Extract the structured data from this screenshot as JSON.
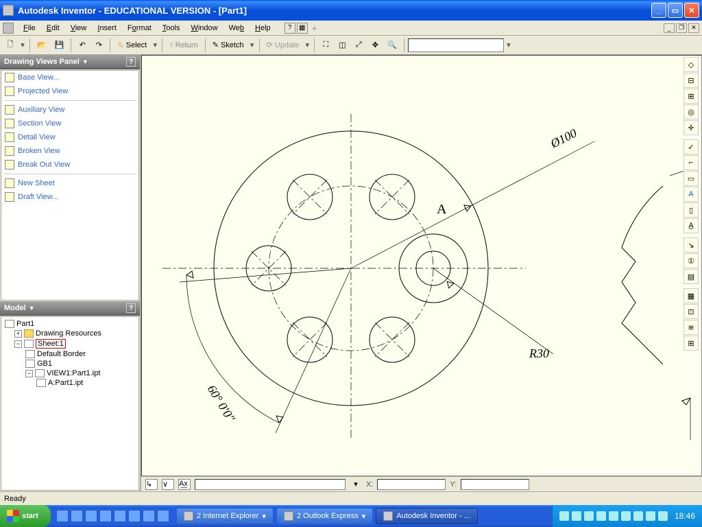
{
  "titlebar": {
    "text": "Autodesk Inventor  - EDUCATIONAL VERSION - [Part1]"
  },
  "menu": {
    "file": "File",
    "edit": "Edit",
    "view": "View",
    "insert": "Insert",
    "format": "Format",
    "tools": "Tools",
    "window": "Window",
    "web": "Web",
    "help": "Help"
  },
  "toolbar": {
    "select": "Select",
    "return": "Return",
    "sketch": "Sketch",
    "update": "Update"
  },
  "panels": {
    "views_title": "Drawing Views Panel",
    "model_title": "Model",
    "items": {
      "base": "Base View...",
      "projected": "Projected View",
      "aux": "Auxiliary View",
      "section": "Section View",
      "detail": "Detail View",
      "broken": "Broken View",
      "breakout": "Break Out View",
      "newsheet": "New Sheet",
      "draft": "Draft View..."
    }
  },
  "tree": {
    "root": "Part1",
    "res": "Drawing Resources",
    "sheet": "Sheet:1",
    "border": "Default Border",
    "gb": "GB1",
    "view": "VIEW1:Part1.ipt",
    "a": "A:Part1.ipt"
  },
  "drawing": {
    "diam": "Ø100",
    "radius": "R30",
    "angle": "60° 0'0\"",
    "label": "A"
  },
  "canvasbar": {
    "x": "X:",
    "y": "Y:"
  },
  "status": {
    "ready": "Ready"
  },
  "taskbar": {
    "start": "start",
    "t1": "2 Internet Explorer",
    "t2": "2 Outlook Express",
    "t3": "Autodesk Inventor  - ...",
    "clock": "18:46"
  }
}
